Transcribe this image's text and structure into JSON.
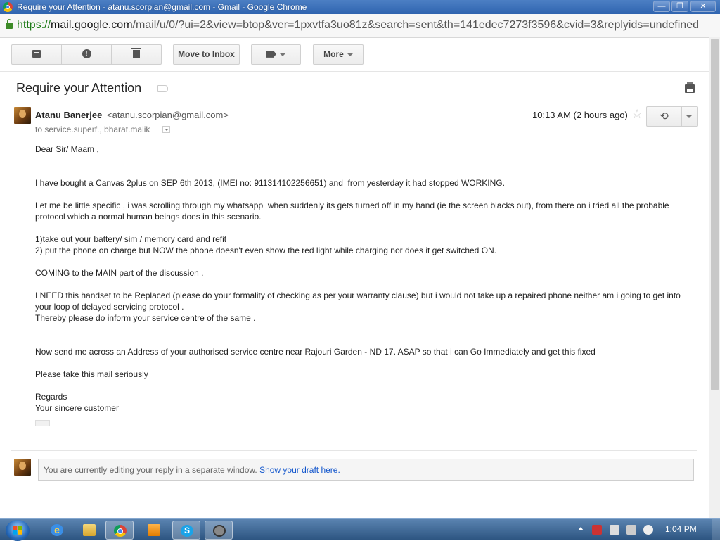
{
  "window": {
    "title": "Require your Attention - atanu.scorpian@gmail.com - Gmail - Google Chrome",
    "min_label": "—",
    "max_label": "❐",
    "close_label": "✕"
  },
  "address": {
    "scheme": "https://",
    "host": "mail.google.com",
    "path": "/mail/u/0/?ui=2&view=btop&ver=1pxvtfa3uo81z&search=sent&th=141edec7273f3596&cvid=3&replyids=undefined"
  },
  "toolbar": {
    "spam_glyph": "!",
    "move_to_inbox_label": "Move to Inbox",
    "more_label": "More"
  },
  "thread": {
    "subject": "Require your Attention"
  },
  "message": {
    "sender_name": "Atanu Banerjee",
    "sender_email": "<atanu.scorpian@gmail.com>",
    "recipients": "to service.superf., bharat.malik",
    "time": "10:13 AM (2 hours ago)",
    "star_glyph": "☆",
    "reply_glyph": "⟲",
    "trimmed_glyph": "...",
    "body": [
      "Dear Sir/ Maam ,",
      "",
      "",
      "I have bought a Canvas 2plus on SEP 6th 2013, (IMEI no: 911314102256651) and  from yesterday it had stopped WORKING.",
      "",
      "Let me be little specific , i was scrolling through my whatsapp  when suddenly its gets turned off in my hand (ie the screen blacks out), from there on i tried all the probable protocol which a normal human beings does in this scenario.",
      "",
      "1)take out your battery/ sim / memory card and refit",
      "2) put the phone on charge but NOW the phone doesn't even show the red light while charging nor does it get switched ON.",
      "",
      "COMING to the MAIN part of the discussion .",
      "",
      "I NEED this handset to be Replaced (please do your formality of checking as per your warranty clause) but i would not take up a repaired phone neither am i going to get into your loop of delayed servicing protocol .",
      "Thereby please do inform your service centre of the same .",
      "",
      "",
      "Now send me across an Address of your authorised service centre near Rajouri Garden - ND 17. ASAP so that i can Go Immediately and get this fixed",
      "",
      "Please take this mail seriously",
      "",
      "Regards",
      "Your sincere customer"
    ]
  },
  "reply_notice": {
    "text": "You are currently editing your reply in a separate window. ",
    "link": "Show your draft here."
  },
  "taskbar": {
    "ie_glyph": "e",
    "skype_glyph": "S",
    "clock": "1:04 PM"
  }
}
